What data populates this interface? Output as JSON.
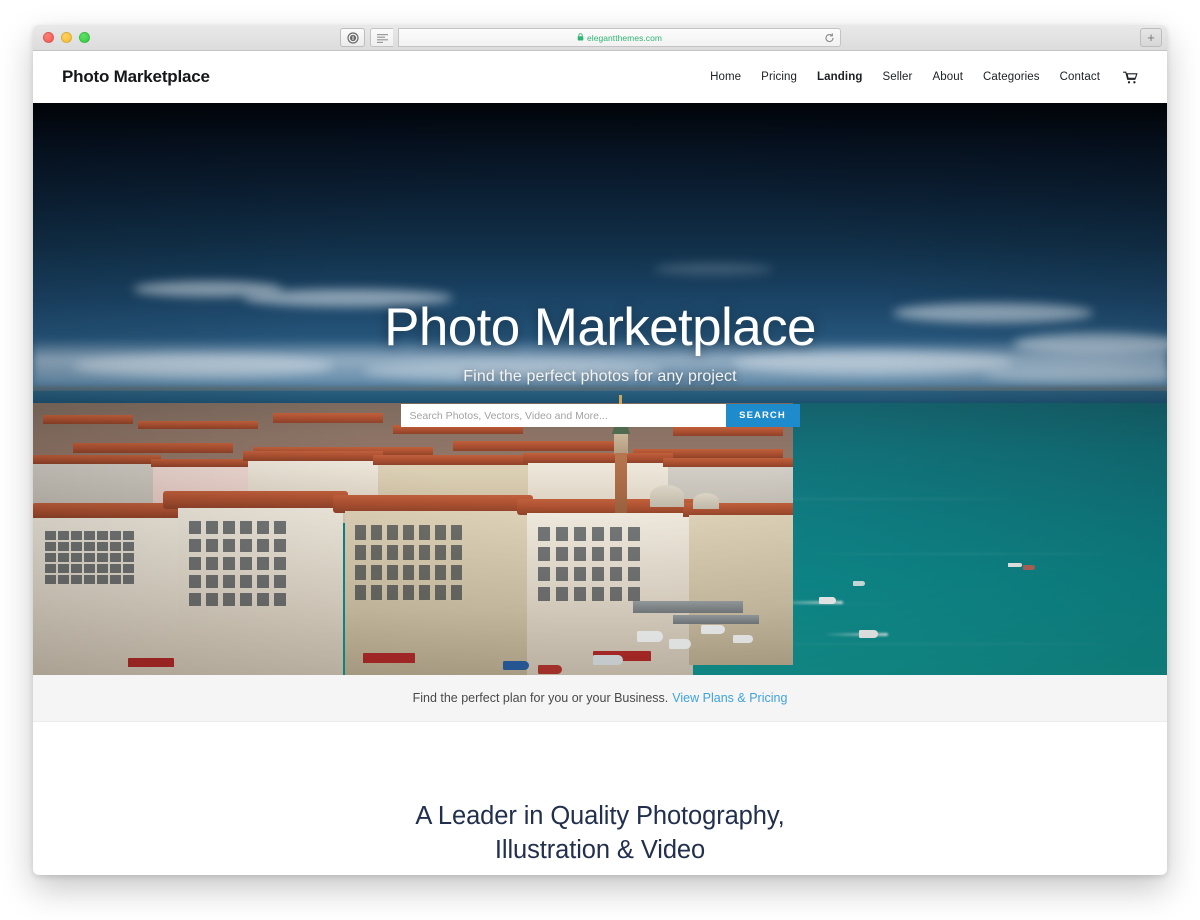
{
  "browser": {
    "url": "elegantthemes.com",
    "lock_icon": "lock-icon",
    "reader_icon": "reader-view-icon",
    "shield_icon": "privacy-shield-icon",
    "reload_icon": "reload-icon",
    "new_tab_label": "+",
    "traffic_lights": [
      "close",
      "minimize",
      "zoom"
    ]
  },
  "header": {
    "logo": "Photo Marketplace",
    "nav": [
      {
        "label": "Home",
        "active": false
      },
      {
        "label": "Pricing",
        "active": false
      },
      {
        "label": "Landing",
        "active": true
      },
      {
        "label": "Seller",
        "active": false
      },
      {
        "label": "About",
        "active": false
      },
      {
        "label": "Categories",
        "active": false
      },
      {
        "label": "Contact",
        "active": false
      }
    ],
    "cart_icon": "shopping-cart-icon"
  },
  "hero": {
    "title": "Photo Marketplace",
    "subtitle": "Find the perfect photos for any project",
    "search_placeholder": "Search Photos, Vectors, Video and More...",
    "search_value": "",
    "search_button": "SEARCH",
    "image_description": "Aerial view of Venice with terracotta rooftops, St Mark's Campanile and teal lagoon with boats"
  },
  "plan_bar": {
    "text": "Find the perfect plan for you or your Business.",
    "link": "View Plans & Pricing"
  },
  "lower": {
    "heading_line1": "A Leader in Quality Photography,",
    "heading_line2": "Illustration & Video"
  },
  "colors": {
    "accent_blue": "#1e8bcd",
    "link_blue": "#3fa2e0",
    "heading_navy": "#22304d",
    "url_green": "#2fb574",
    "plan_bar_bg": "#f5f5f5"
  }
}
